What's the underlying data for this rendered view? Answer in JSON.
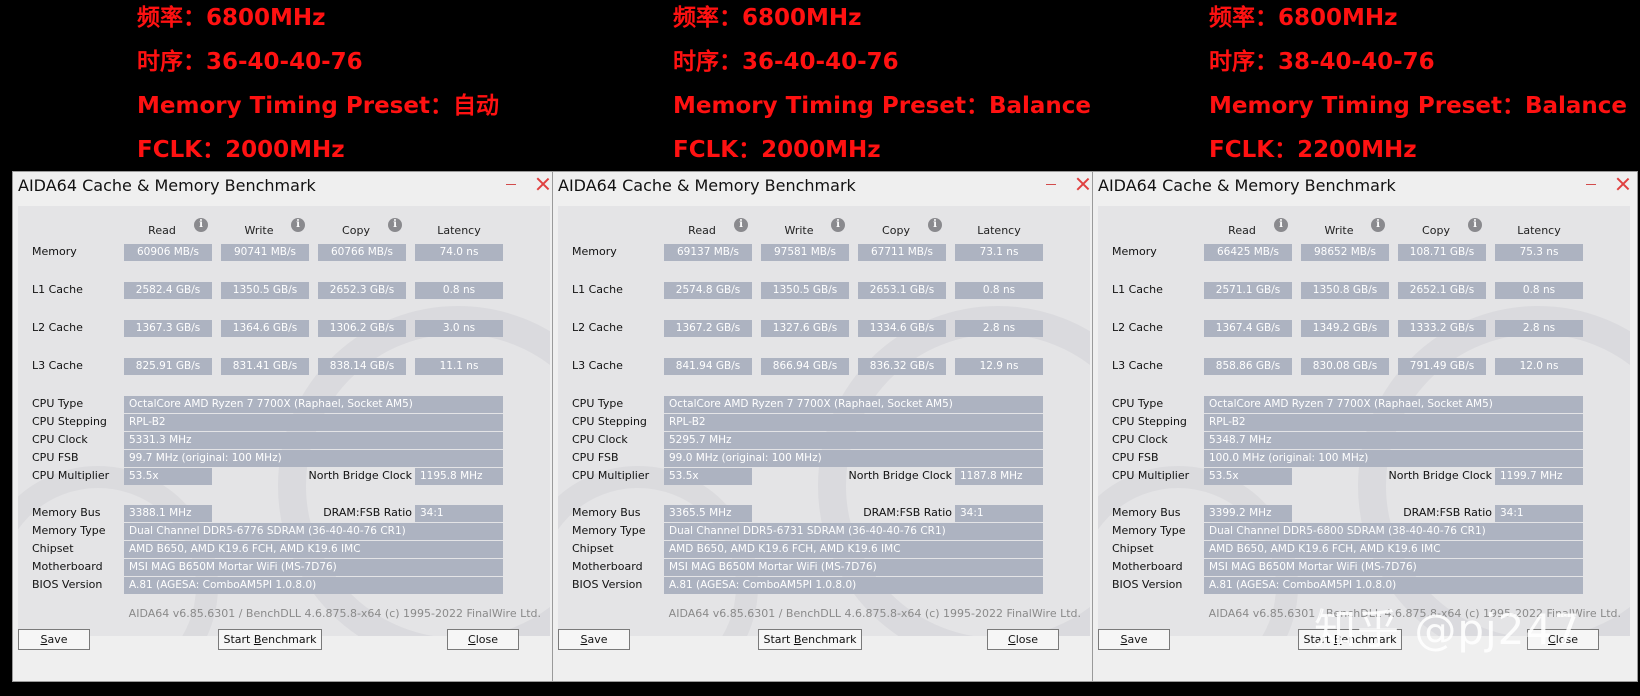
{
  "headers": [
    {
      "freq": "频率：6800MHz",
      "timing": "时序：36-40-40-76",
      "preset": "Memory Timing Preset：自动",
      "fclk": "FCLK：2000MHz"
    },
    {
      "freq": "频率：6800MHz",
      "timing": "时序：36-40-40-76",
      "preset": "Memory Timing Preset：Balance",
      "fclk": "FCLK：2000MHz"
    },
    {
      "freq": "频率：6800MHz",
      "timing": "时序：38-40-40-76",
      "preset": "Memory Timing Preset：Balance",
      "fclk": "FCLK：2200MHz"
    }
  ],
  "window": {
    "title": "AIDA64 Cache & Memory Benchmark",
    "col_read": "Read",
    "col_write": "Write",
    "col_copy": "Copy",
    "col_latency": "Latency",
    "lbl_memory": "Memory",
    "lbl_l1": "L1 Cache",
    "lbl_l2": "L2 Cache",
    "lbl_l3": "L3 Cache",
    "lbl_cpu_type": "CPU Type",
    "lbl_cpu_stepping": "CPU Stepping",
    "lbl_cpu_clock": "CPU Clock",
    "lbl_cpu_fsb": "CPU FSB",
    "lbl_cpu_multiplier": "CPU Multiplier",
    "lbl_nb_clock": "North Bridge Clock",
    "lbl_memory_bus": "Memory Bus",
    "lbl_dram_fsb": "DRAM:FSB Ratio",
    "lbl_memory_type": "Memory Type",
    "lbl_chipset": "Chipset",
    "lbl_motherboard": "Motherboard",
    "lbl_bios": "BIOS Version",
    "footer": "AIDA64 v6.85.6301 / BenchDLL 4.6.875.8-x64  (c) 1995-2022 FinalWire Ltd.",
    "btn_save_u": "S",
    "btn_save_rest": "ave",
    "btn_start": "Start ",
    "btn_start_u": "B",
    "btn_start_rest": "enchmark",
    "btn_close_u": "C",
    "btn_close_rest": "lose"
  },
  "windows": [
    {
      "memory": {
        "read": "60906 MB/s",
        "write": "90741 MB/s",
        "copy": "60766 MB/s",
        "latency": "74.0 ns"
      },
      "l1": {
        "read": "2582.4 GB/s",
        "write": "1350.5 GB/s",
        "copy": "2652.3 GB/s",
        "latency": "0.8 ns"
      },
      "l2": {
        "read": "1367.3 GB/s",
        "write": "1364.6 GB/s",
        "copy": "1306.2 GB/s",
        "latency": "3.0 ns"
      },
      "l3": {
        "read": "825.91 GB/s",
        "write": "831.41 GB/s",
        "copy": "838.14 GB/s",
        "latency": "11.1 ns"
      },
      "cpu_type": "OctalCore AMD Ryzen 7 7700X  (Raphael, Socket AM5)",
      "cpu_stepping": "RPL-B2",
      "cpu_clock": "5331.3 MHz",
      "cpu_fsb": "99.7 MHz  (original: 100 MHz)",
      "cpu_multiplier": "53.5x",
      "nb_clock": "1195.8 MHz",
      "memory_bus": "3388.1 MHz",
      "dram_fsb": "34:1",
      "memory_type": "Dual Channel DDR5-6776 SDRAM  (36-40-40-76 CR1)",
      "chipset": "AMD B650, AMD K19.6 FCH, AMD K19.6 IMC",
      "motherboard": "MSI MAG B650M Mortar WiFi (MS-7D76)",
      "bios": "A.81  (AGESA: ComboAM5PI 1.0.8.0)"
    },
    {
      "memory": {
        "read": "69137 MB/s",
        "write": "97581 MB/s",
        "copy": "67711 MB/s",
        "latency": "73.1 ns"
      },
      "l1": {
        "read": "2574.8 GB/s",
        "write": "1350.5 GB/s",
        "copy": "2653.1 GB/s",
        "latency": "0.8 ns"
      },
      "l2": {
        "read": "1367.2 GB/s",
        "write": "1327.6 GB/s",
        "copy": "1334.6 GB/s",
        "latency": "2.8 ns"
      },
      "l3": {
        "read": "841.94 GB/s",
        "write": "866.94 GB/s",
        "copy": "836.32 GB/s",
        "latency": "12.9 ns"
      },
      "cpu_type": "OctalCore AMD Ryzen 7 7700X  (Raphael, Socket AM5)",
      "cpu_stepping": "RPL-B2",
      "cpu_clock": "5295.7 MHz",
      "cpu_fsb": "99.0 MHz  (original: 100 MHz)",
      "cpu_multiplier": "53.5x",
      "nb_clock": "1187.8 MHz",
      "memory_bus": "3365.5 MHz",
      "dram_fsb": "34:1",
      "memory_type": "Dual Channel DDR5-6731 SDRAM  (36-40-40-76 CR1)",
      "chipset": "AMD B650, AMD K19.6 FCH, AMD K19.6 IMC",
      "motherboard": "MSI MAG B650M Mortar WiFi (MS-7D76)",
      "bios": "A.81  (AGESA: ComboAM5PI 1.0.8.0)"
    },
    {
      "memory": {
        "read": "66425 MB/s",
        "write": "98652 MB/s",
        "copy": "108.71 GB/s",
        "latency": "75.3 ns"
      },
      "l1": {
        "read": "2571.1 GB/s",
        "write": "1350.8 GB/s",
        "copy": "2652.1 GB/s",
        "latency": "0.8 ns"
      },
      "l2": {
        "read": "1367.4 GB/s",
        "write": "1349.2 GB/s",
        "copy": "1333.2 GB/s",
        "latency": "2.8 ns"
      },
      "l3": {
        "read": "858.86 GB/s",
        "write": "830.08 GB/s",
        "copy": "791.49 GB/s",
        "latency": "12.0 ns"
      },
      "cpu_type": "OctalCore AMD Ryzen 7 7700X  (Raphael, Socket AM5)",
      "cpu_stepping": "RPL-B2",
      "cpu_clock": "5348.7 MHz",
      "cpu_fsb": "100.0 MHz  (original: 100 MHz)",
      "cpu_multiplier": "53.5x",
      "nb_clock": "1199.7 MHz",
      "memory_bus": "3399.2 MHz",
      "dram_fsb": "34:1",
      "memory_type": "Dual Channel DDR5-6800 SDRAM  (38-40-40-76 CR1)",
      "chipset": "AMD B650, AMD K19.6 FCH, AMD K19.6 IMC",
      "motherboard": "MSI MAG B650M Mortar WiFi (MS-7D76)",
      "bios": "A.81  (AGESA: ComboAM5PI 1.0.8.0)"
    }
  ],
  "watermark": "知乎 @pj247"
}
